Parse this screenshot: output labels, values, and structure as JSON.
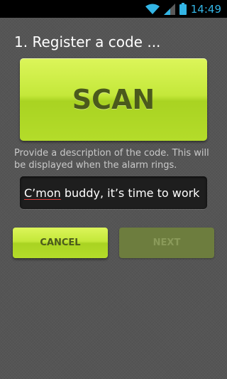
{
  "status_bar": {
    "time": "14:49",
    "icons": [
      "wifi-icon",
      "signal-icon",
      "battery-icon"
    ],
    "time_color": "#33b5e5"
  },
  "heading": "1. Register a code ...",
  "scan_button": {
    "label": "SCAN"
  },
  "description": "Provide a description of the code. This will be displayed when the alarm rings.",
  "alarm_description_field": {
    "value_prefix": "C’mon",
    "value_rest": " buddy, it’s time to work"
  },
  "buttons": {
    "cancel_label": "CANCEL",
    "next_label": "NEXT",
    "next_enabled": false
  },
  "colors": {
    "accent": "#c4e83a",
    "background": "#555555",
    "input_background": "#1e1e1e"
  }
}
